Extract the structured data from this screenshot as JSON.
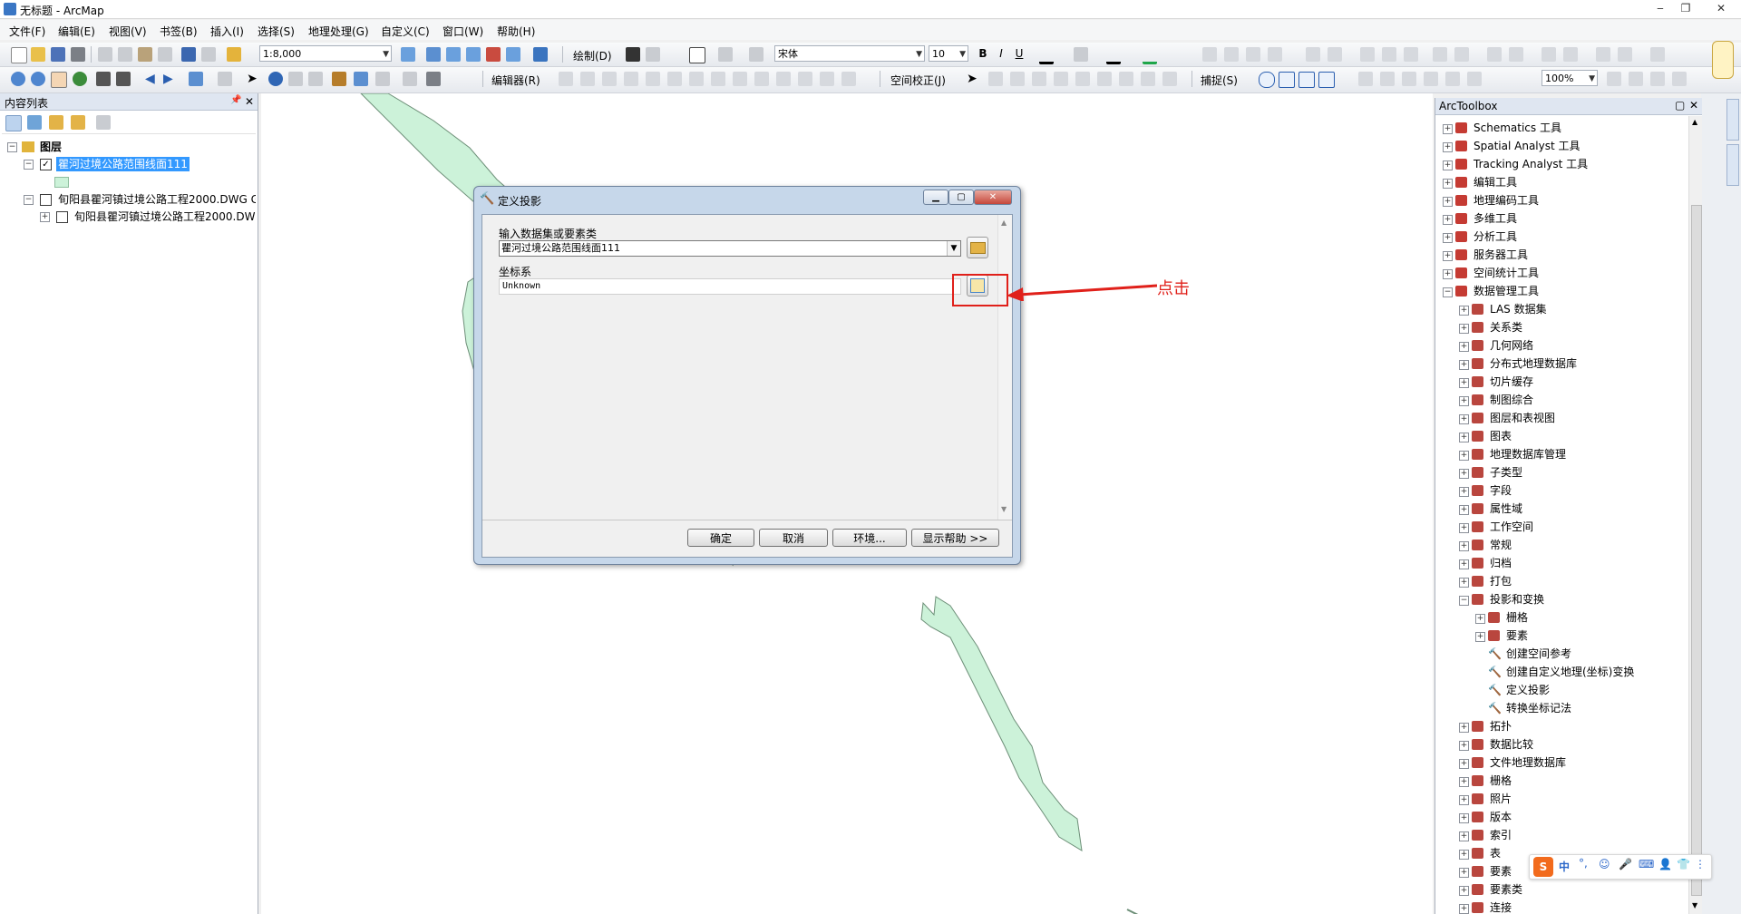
{
  "window": {
    "title": "无标题 - ArcMap"
  },
  "menu": [
    "文件(F)",
    "编辑(E)",
    "视图(V)",
    "书签(B)",
    "插入(I)",
    "选择(S)",
    "地理处理(G)",
    "自定义(C)",
    "窗口(W)",
    "帮助(H)"
  ],
  "toolbar": {
    "scale": "1:8,000",
    "draw_label": "绘制(D)",
    "font_name": "宋体",
    "font_size": "10",
    "editor_label": "编辑器(R)",
    "georef_label": "空间校正(J)",
    "snap_label": "捕捉(S)",
    "zoom": "100%"
  },
  "toc": {
    "title": "内容列表",
    "root": "图层",
    "layers": [
      "瞿河过境公路范围线面111",
      "旬阳县瞿河镇过境公路工程2000.DWG G",
      "旬阳县瞿河镇过境公路工程2000.DW"
    ]
  },
  "dialog": {
    "title": "定义投影",
    "input_label": "输入数据集或要素类",
    "input_value": "瞿河过境公路范围线面111",
    "cs_label": "坐标系",
    "cs_value": "Unknown",
    "buttons": {
      "ok": "确定",
      "cancel": "取消",
      "env": "环境...",
      "help": "显示帮助 >>"
    }
  },
  "annotation": {
    "text": "点击",
    "color": "#e0201a"
  },
  "toolbox": {
    "title": "ArcToolbox",
    "items": [
      {
        "label": "Schematics 工具",
        "level": 0,
        "kind": "box",
        "exp": "+"
      },
      {
        "label": "Spatial Analyst 工具",
        "level": 0,
        "kind": "box",
        "exp": "+"
      },
      {
        "label": "Tracking Analyst 工具",
        "level": 0,
        "kind": "box",
        "exp": "+"
      },
      {
        "label": "编辑工具",
        "level": 0,
        "kind": "box",
        "exp": "+"
      },
      {
        "label": "地理编码工具",
        "level": 0,
        "kind": "box",
        "exp": "+"
      },
      {
        "label": "多维工具",
        "level": 0,
        "kind": "box",
        "exp": "+"
      },
      {
        "label": "分析工具",
        "level": 0,
        "kind": "box",
        "exp": "+"
      },
      {
        "label": "服务器工具",
        "level": 0,
        "kind": "box",
        "exp": "+"
      },
      {
        "label": "空间统计工具",
        "level": 0,
        "kind": "box",
        "exp": "+"
      },
      {
        "label": "数据管理工具",
        "level": 0,
        "kind": "box",
        "exp": "-"
      },
      {
        "label": "LAS 数据集",
        "level": 1,
        "kind": "set",
        "exp": "+"
      },
      {
        "label": "关系类",
        "level": 1,
        "kind": "set",
        "exp": "+"
      },
      {
        "label": "几何网络",
        "level": 1,
        "kind": "set",
        "exp": "+"
      },
      {
        "label": "分布式地理数据库",
        "level": 1,
        "kind": "set",
        "exp": "+"
      },
      {
        "label": "切片缓存",
        "level": 1,
        "kind": "set",
        "exp": "+"
      },
      {
        "label": "制图综合",
        "level": 1,
        "kind": "set",
        "exp": "+"
      },
      {
        "label": "图层和表视图",
        "level": 1,
        "kind": "set",
        "exp": "+"
      },
      {
        "label": "图表",
        "level": 1,
        "kind": "set",
        "exp": "+"
      },
      {
        "label": "地理数据库管理",
        "level": 1,
        "kind": "set",
        "exp": "+"
      },
      {
        "label": "子类型",
        "level": 1,
        "kind": "set",
        "exp": "+"
      },
      {
        "label": "字段",
        "level": 1,
        "kind": "set",
        "exp": "+"
      },
      {
        "label": "属性域",
        "level": 1,
        "kind": "set",
        "exp": "+"
      },
      {
        "label": "工作空间",
        "level": 1,
        "kind": "set",
        "exp": "+"
      },
      {
        "label": "常规",
        "level": 1,
        "kind": "set",
        "exp": "+"
      },
      {
        "label": "归档",
        "level": 1,
        "kind": "set",
        "exp": "+"
      },
      {
        "label": "打包",
        "level": 1,
        "kind": "set",
        "exp": "+"
      },
      {
        "label": "投影和变换",
        "level": 1,
        "kind": "set",
        "exp": "-"
      },
      {
        "label": "栅格",
        "level": 2,
        "kind": "set",
        "exp": "+"
      },
      {
        "label": "要素",
        "level": 2,
        "kind": "set",
        "exp": "+"
      },
      {
        "label": "创建空间参考",
        "level": 2,
        "kind": "tool",
        "exp": ""
      },
      {
        "label": "创建自定义地理(坐标)变换",
        "level": 2,
        "kind": "tool",
        "exp": ""
      },
      {
        "label": "定义投影",
        "level": 2,
        "kind": "tool",
        "exp": ""
      },
      {
        "label": "转换坐标记法",
        "level": 2,
        "kind": "tool",
        "exp": ""
      },
      {
        "label": "拓扑",
        "level": 1,
        "kind": "set",
        "exp": "+"
      },
      {
        "label": "数据比较",
        "level": 1,
        "kind": "set",
        "exp": "+"
      },
      {
        "label": "文件地理数据库",
        "level": 1,
        "kind": "set",
        "exp": "+"
      },
      {
        "label": "栅格",
        "level": 1,
        "kind": "set",
        "exp": "+"
      },
      {
        "label": "照片",
        "level": 1,
        "kind": "set",
        "exp": "+"
      },
      {
        "label": "版本",
        "level": 1,
        "kind": "set",
        "exp": "+"
      },
      {
        "label": "索引",
        "level": 1,
        "kind": "set",
        "exp": "+"
      },
      {
        "label": "表",
        "level": 1,
        "kind": "set",
        "exp": "+"
      },
      {
        "label": "要素",
        "level": 1,
        "kind": "set",
        "exp": "+"
      },
      {
        "label": "要素类",
        "level": 1,
        "kind": "set",
        "exp": "+"
      },
      {
        "label": "连接",
        "level": 1,
        "kind": "set",
        "exp": "+"
      }
    ]
  },
  "ime": {
    "lang": "中"
  }
}
